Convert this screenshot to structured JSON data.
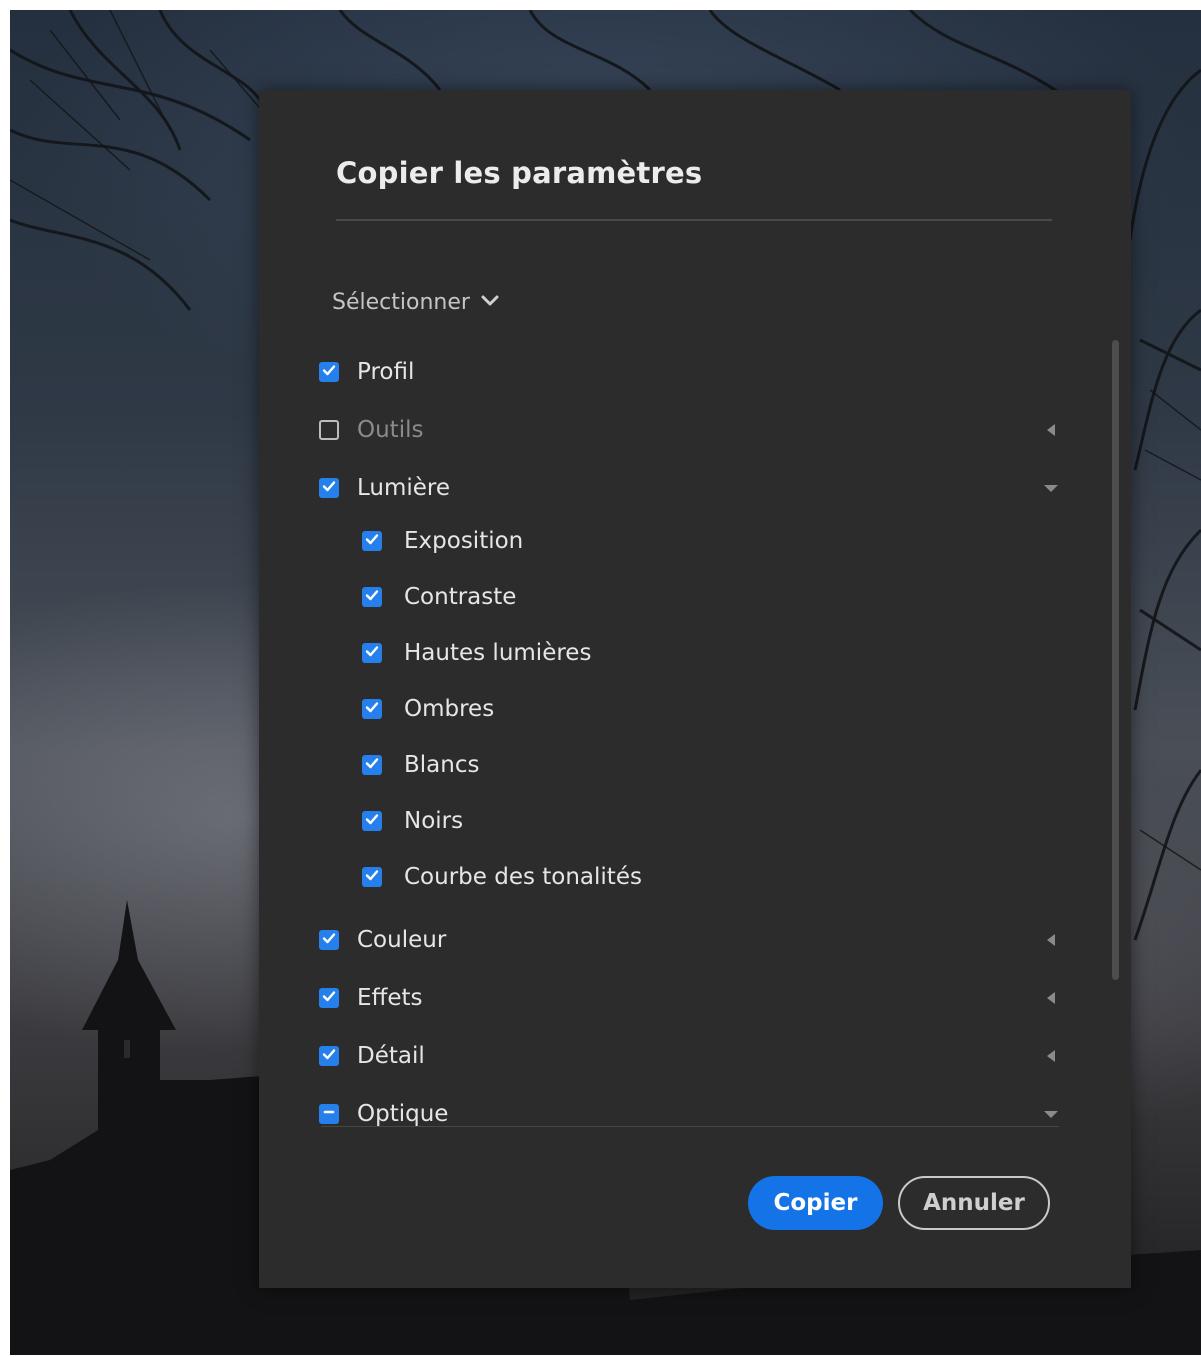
{
  "dialog": {
    "title": "Copier les paramètres",
    "select_label": "Sélectionner",
    "items": [
      {
        "label": "Profil",
        "state": "checked",
        "disclosure": "none",
        "muted": false
      },
      {
        "label": "Outils",
        "state": "unchecked",
        "disclosure": "collapsed",
        "muted": true
      },
      {
        "label": "Lumière",
        "state": "checked",
        "disclosure": "expanded",
        "muted": false
      },
      {
        "label": "Couleur",
        "state": "checked",
        "disclosure": "collapsed",
        "muted": false
      },
      {
        "label": "Effets",
        "state": "checked",
        "disclosure": "collapsed",
        "muted": false
      },
      {
        "label": "Détail",
        "state": "checked",
        "disclosure": "collapsed",
        "muted": false
      },
      {
        "label": "Optique",
        "state": "indeterminate",
        "disclosure": "expanded",
        "muted": false
      }
    ],
    "lumiere_children": [
      {
        "label": "Exposition",
        "state": "checked"
      },
      {
        "label": "Contraste",
        "state": "checked"
      },
      {
        "label": "Hautes lumières",
        "state": "checked"
      },
      {
        "label": "Ombres",
        "state": "checked"
      },
      {
        "label": "Blancs",
        "state": "checked"
      },
      {
        "label": "Noirs",
        "state": "checked"
      },
      {
        "label": "Courbe des tonalités",
        "state": "checked"
      }
    ],
    "buttons": {
      "copy_label": "Copier",
      "cancel_label": "Annuler"
    }
  },
  "colors": {
    "accent": "#1473e6",
    "checkbox": "#2680eb",
    "dialog_bg": "#2c2c2c"
  },
  "icons": {
    "select_chevron": "chevron-down-icon",
    "collapsed": "triangle-left-icon",
    "expanded": "triangle-down-icon",
    "checked": "checkmark-icon",
    "indeterminate": "dash-icon"
  }
}
